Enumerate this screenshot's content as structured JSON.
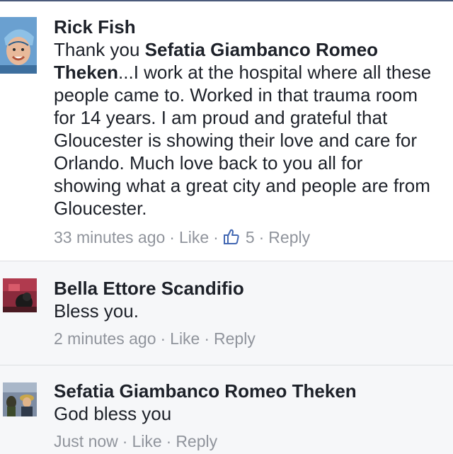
{
  "comments": [
    {
      "author": "Rick Fish",
      "text_lines": [
        {
          "prefix": "Thank you ",
          "bold": "Sefatia Giambanco Romeo",
          "suffix": ""
        },
        {
          "prefix": "",
          "bold": "Theken",
          "suffix": "...I work at the hospital where all these"
        },
        {
          "prefix": "people came to.  Worked in that trauma room",
          "bold": "",
          "suffix": ""
        },
        {
          "prefix": "for 14 years.  I am proud and grateful that",
          "bold": "",
          "suffix": ""
        },
        {
          "prefix": "Gloucester is showing their love and care for",
          "bold": "",
          "suffix": ""
        },
        {
          "prefix": "Orlando.   Much love back to you all for",
          "bold": "",
          "suffix": ""
        },
        {
          "prefix": "showing what a great city and people are from",
          "bold": "",
          "suffix": ""
        },
        {
          "prefix": "Gloucester.",
          "bold": "",
          "suffix": ""
        }
      ],
      "time": "33 minutes ago",
      "like_label": "Like",
      "reaction_count": "5",
      "reply_label": "Reply",
      "separator": "·"
    },
    {
      "author": "Bella Ettore Scandifio",
      "text": "Bless you.",
      "time": "2 minutes ago",
      "like_label": "Like",
      "reply_label": "Reply",
      "separator": "·"
    },
    {
      "author": "Sefatia Giambanco Romeo Theken",
      "text": "God bless you",
      "time": "Just now",
      "like_label": "Like",
      "reply_label": "Reply",
      "separator": "·"
    }
  ],
  "colors": {
    "text": "#1d2129",
    "meta": "#90949c",
    "like_icon": "#4267b2",
    "reply_bg": "#f6f7f9",
    "divider": "#dddfe2"
  },
  "icons": {
    "reaction": "thumbs-up-icon"
  }
}
